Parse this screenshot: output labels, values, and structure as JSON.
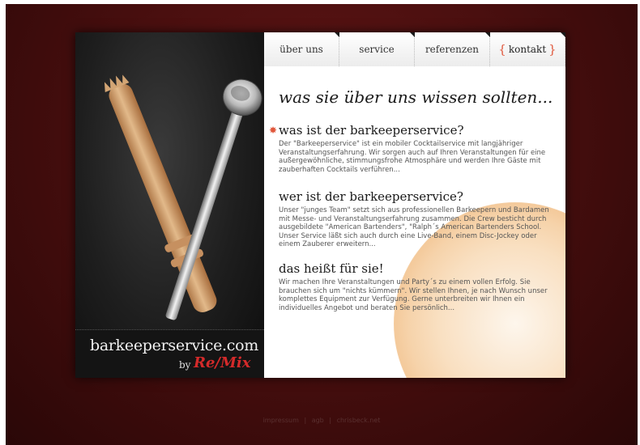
{
  "nav": {
    "tabs": [
      {
        "label": "über uns"
      },
      {
        "label": "service"
      },
      {
        "label": "referenzen"
      },
      {
        "label": "kontakt"
      }
    ],
    "brace_open": "{",
    "brace_close": "}"
  },
  "brand": {
    "name": "barkeeperservice.com",
    "by": "by",
    "logo": "Re/Mix"
  },
  "main": {
    "headline": "was sie über uns wissen sollten...",
    "sections": [
      {
        "title": "was ist der barkeeperservice?",
        "text": "Der \"Barkeeperservice\" ist ein mobiler Cocktailservice mit langjähriger Veranstaltungserfahrung. Wir sorgen auch auf Ihren Veranstaltungen für eine außergewöhnliche, stimmungsfrohe Atmosphäre und werden Ihre Gäste mit zauberhaften Cocktails verführen..."
      },
      {
        "title": "wer ist der barkeeperservice?",
        "text": "Unser \"junges Team\" setzt sich aus professionellen Barkeepern und Bardamen mit Messe- und Veranstaltungserfahrung zusammen. Die Crew besticht durch ausgebildete \"American Bartenders\", \"Ralph´s American Bartenders School. Unser Service läßt sich auch durch eine Live-Band, einem Disc-Jockey oder einem Zauberer erweitern..."
      },
      {
        "title": "das heißt für sie!",
        "text": "Wir machen Ihre Veranstaltungen und Party´s zu einem vollen Erfolg. Sie brauchen sich um \"nichts kümmern\". Wir stellen Ihnen, je nach Wunsch unser komplettes Equipment zur Verfügung. Gerne unterbreiten wir Ihnen ein individuelles Angebot und beraten Sie persönlich..."
      }
    ]
  },
  "footer": {
    "links": [
      "impressum",
      "agb",
      "chrisbeck.net"
    ],
    "separator": "|"
  },
  "colors": {
    "accent": "#e0563a",
    "background": "#4a0f0f",
    "logo": "#d42a2a"
  }
}
